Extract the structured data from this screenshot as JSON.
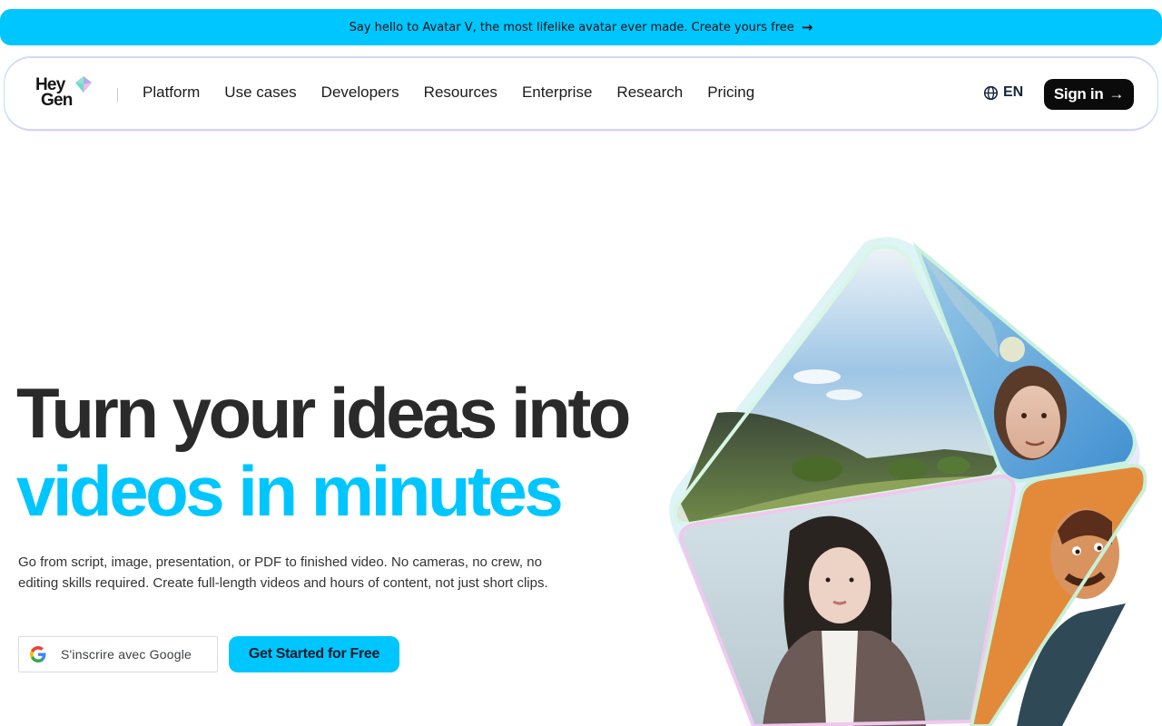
{
  "banner": {
    "text": "Say hello to Avatar V, the most lifelike avatar ever made. Create yours free",
    "arrow": "→"
  },
  "nav": {
    "logo": {
      "line1": "Hey",
      "line2": "Gen"
    },
    "links": [
      "Platform",
      "Use cases",
      "Developers",
      "Resources",
      "Enterprise",
      "Research",
      "Pricing"
    ],
    "language": "EN",
    "language_icon": "globe-icon",
    "signin_label": "Sign in",
    "signin_arrow": "→"
  },
  "hero": {
    "headline_line1": "Turn your ideas into",
    "headline_line2": "videos in minutes",
    "subtext": "Go from script, image, presentation, or PDF to finished video. No cameras, no crew, no editing skills required. Create full-length videos and hours of content, not just short clips.",
    "google_button_label": "S'inscrire avec Google",
    "cta_label": "Get Started for Free"
  },
  "colors": {
    "accent": "#00c6ff",
    "headline_dark": "#2a2a2a",
    "signin_bg": "#0b0b0b"
  }
}
